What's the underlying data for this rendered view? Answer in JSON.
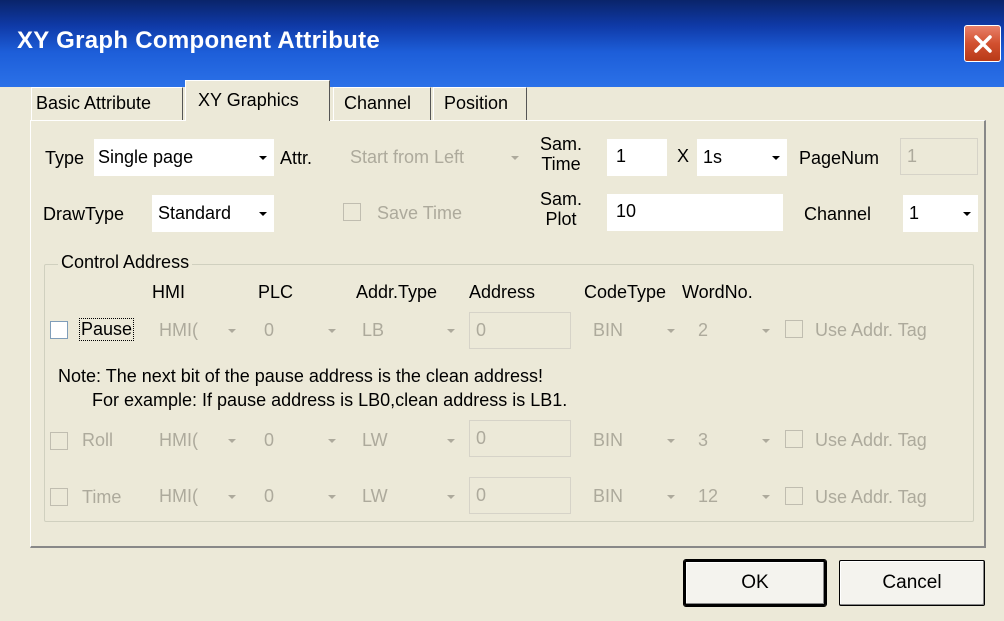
{
  "window": {
    "title": "XY Graph Component Attribute",
    "close_icon": "close-icon"
  },
  "tabs": [
    {
      "label": "Basic Attribute",
      "active": false
    },
    {
      "label": "XY Graphics",
      "active": true
    },
    {
      "label": "Channel",
      "active": false
    },
    {
      "label": "Position",
      "active": false
    }
  ],
  "graphics": {
    "type_label": "Type",
    "type_value": "Single page",
    "attr_label": "Attr.",
    "attr_value": "Start from Left",
    "sam_time_label_1": "Sam.",
    "sam_time_label_2": "Time",
    "sam_time_value": "1",
    "times_symbol": "X",
    "sam_time_unit": "1s",
    "pagenum_label": "PageNum",
    "pagenum_value": "1",
    "drawtype_label": "DrawType",
    "drawtype_value": "Standard",
    "save_time_label": "Save Time",
    "sam_plot_label_1": "Sam.",
    "sam_plot_label_2": "Plot",
    "sam_plot_value": "10",
    "channel_label": "Channel",
    "channel_value": "1"
  },
  "control_address": {
    "group_label": "Control Address",
    "headers": {
      "hmi": "HMI",
      "plc": "PLC",
      "addr_type": "Addr.Type",
      "address": "Address",
      "codetype": "CodeType",
      "wordno": "WordNo."
    },
    "rows": [
      {
        "label": "Pause",
        "hmi": "HMI(",
        "plc": "0",
        "addr_type": "LB",
        "address": "0",
        "codetype": "BIN",
        "wordno": "2",
        "use_tag": "Use Addr. Tag"
      },
      {
        "label": "Roll",
        "hmi": "HMI(",
        "plc": "0",
        "addr_type": "LW",
        "address": "0",
        "codetype": "BIN",
        "wordno": "3",
        "use_tag": "Use Addr. Tag"
      },
      {
        "label": "Time",
        "hmi": "HMI(",
        "plc": "0",
        "addr_type": "LW",
        "address": "0",
        "codetype": "BIN",
        "wordno": "12",
        "use_tag": "Use Addr. Tag"
      }
    ],
    "note_1": "Note: The next bit of the pause address is the clean address!",
    "note_2": "For example: If pause address is LB0,clean address is LB1."
  },
  "buttons": {
    "ok": "OK",
    "cancel": "Cancel"
  }
}
